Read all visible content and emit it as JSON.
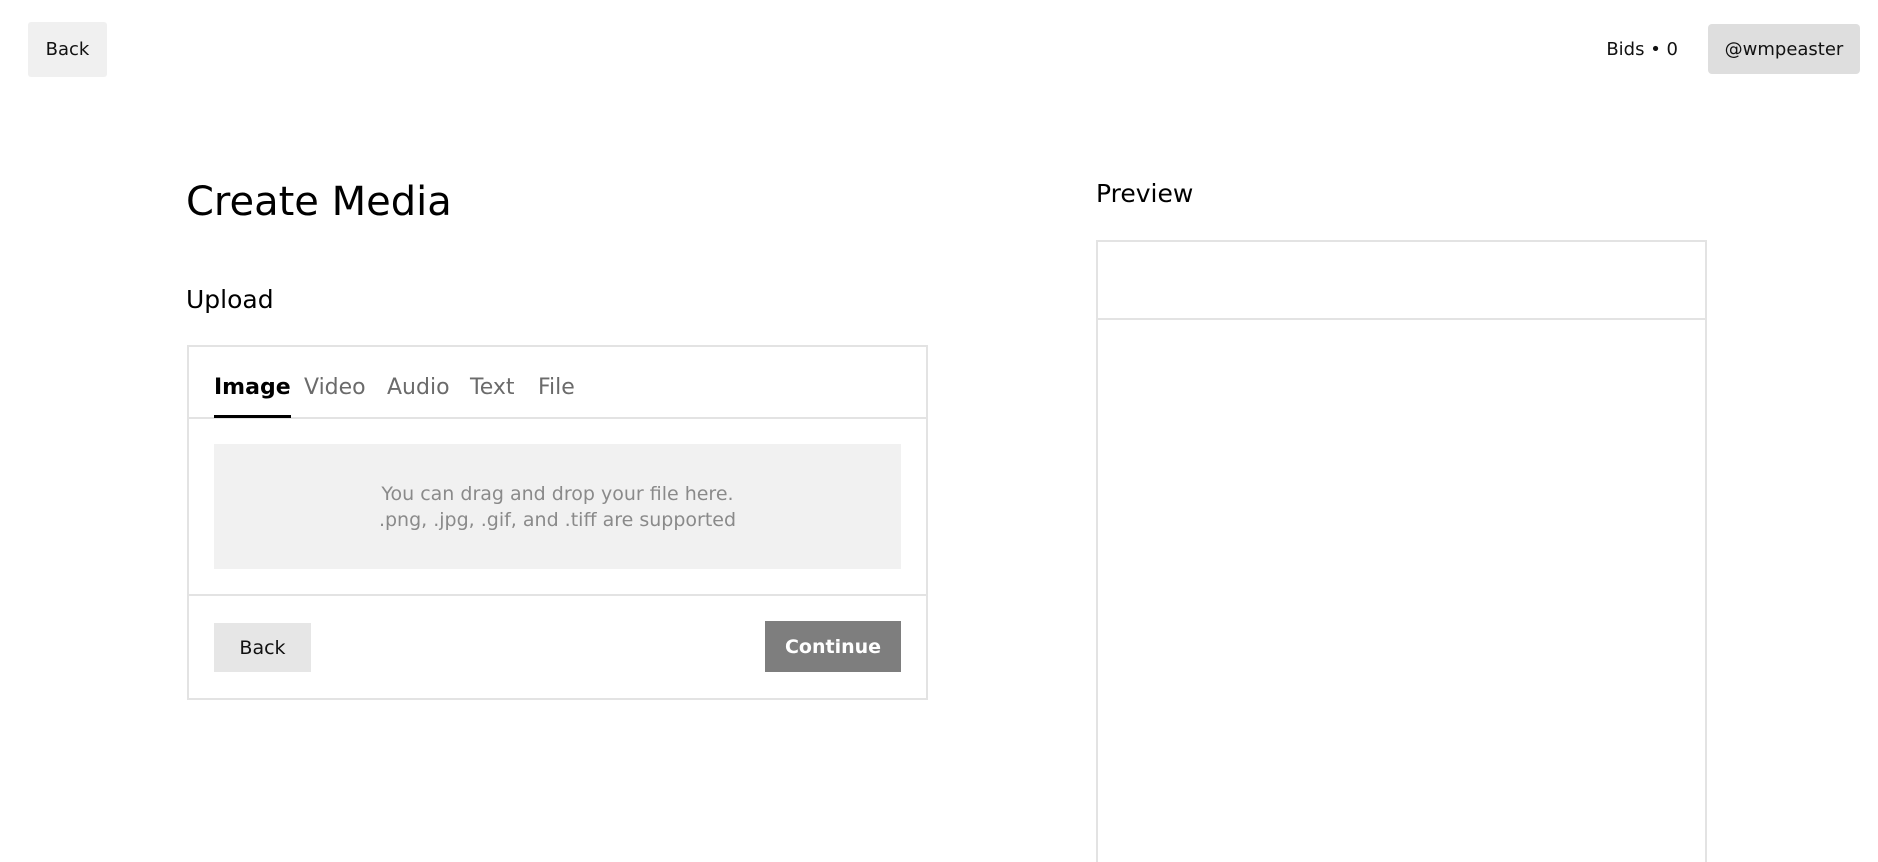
{
  "header": {
    "back_label": "Back",
    "bids_text": "Bids • 0",
    "user_handle": "@wmpeaster"
  },
  "main": {
    "title": "Create Media",
    "upload": {
      "section_title": "Upload",
      "tabs": [
        {
          "label": "Image",
          "active": true
        },
        {
          "label": "Video",
          "active": false
        },
        {
          "label": "Audio",
          "active": false
        },
        {
          "label": "Text",
          "active": false
        },
        {
          "label": "File",
          "active": false
        }
      ],
      "dropzone": {
        "line1": "You can drag and drop your file here.",
        "line2": ".png, .jpg, .gif, and .tiff are supported"
      },
      "footer": {
        "back_label": "Back",
        "continue_label": "Continue"
      }
    }
  },
  "preview": {
    "title": "Preview"
  },
  "colors": {
    "border": "#e3e3e3",
    "dropzone_bg": "#f1f1f1",
    "continue_bg": "#7e7e7e",
    "user_btn_bg": "#dedede"
  }
}
